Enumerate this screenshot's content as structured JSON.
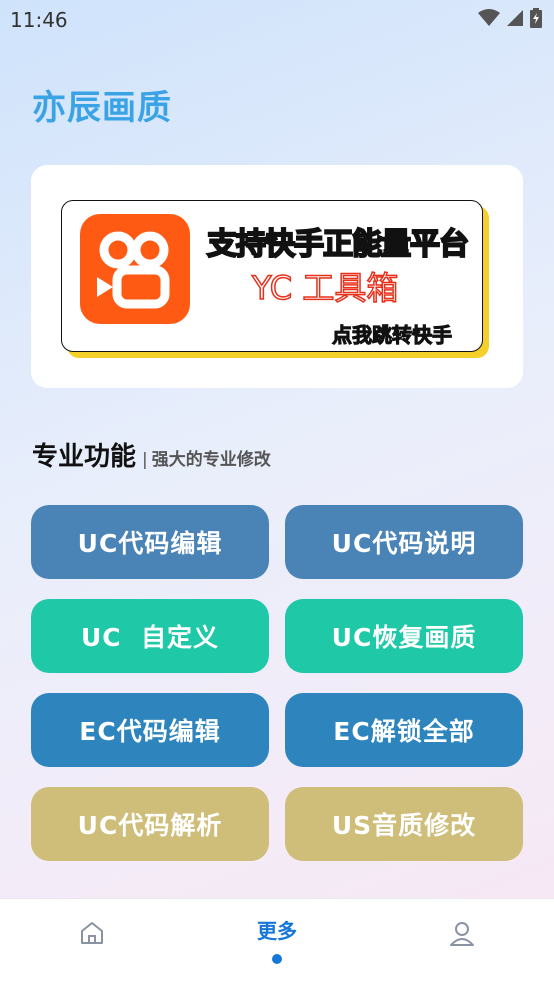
{
  "status_bar": {
    "time": "11:46"
  },
  "app_title": "亦辰画质",
  "banner": {
    "line1": "支持快手正能量平台",
    "line2": "YC 工具箱",
    "line3": "点我跳转快手"
  },
  "section": {
    "title": "专业功能",
    "divider": "|",
    "subtitle": "强大的专业修改"
  },
  "buttons": [
    {
      "label": "UC代码编辑"
    },
    {
      "label": "UC代码说明"
    },
    {
      "label": "UC  自定义"
    },
    {
      "label": "UC恢复画质"
    },
    {
      "label": "EC代码编辑"
    },
    {
      "label": "EC解锁全部"
    },
    {
      "label": "UC代码解析"
    },
    {
      "label": "US音质修改"
    }
  ],
  "colors": {
    "title": "#3aa3e6",
    "row1": "#4a83b6",
    "row2": "#1fc9a7",
    "row3": "#2e84bd",
    "row4": "#cfbe7a",
    "nav_active": "#1677d9"
  },
  "bottom_nav": {
    "home_icon": "home-icon",
    "more_label": "更多",
    "profile_icon": "user-icon"
  }
}
